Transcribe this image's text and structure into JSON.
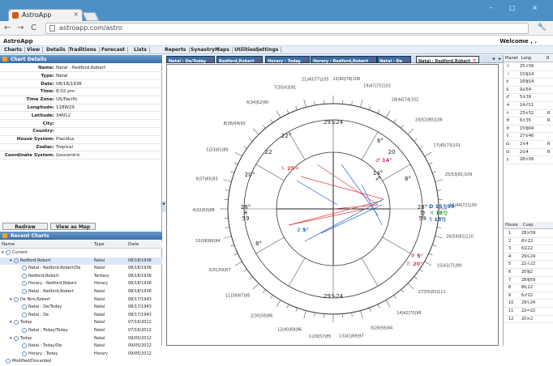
{
  "browser": {
    "tab_title": "AstroApp",
    "tab_close": "×",
    "window_controls": "– □ ×",
    "url": "astroapp.com/astro",
    "back_glyph": "←",
    "forward_glyph": "→",
    "reload_glyph": "C",
    "wrench_glyph": "🔧"
  },
  "app": {
    "name": "AstroApp",
    "welcome": "Welcome , ."
  },
  "menu": [
    "Charts",
    "View",
    "Details",
    "Traditions",
    "Forecast",
    "Lists",
    "Reports",
    "Synastry",
    "Maps",
    "Utilities",
    "Settings"
  ],
  "chart_details": {
    "header": "Chart Details",
    "rows": [
      {
        "label": "Name:",
        "value": "Natal : Redford,Robert"
      },
      {
        "label": "Type:",
        "value": "Natal"
      },
      {
        "label": "Date:",
        "value": "08/18/1936"
      },
      {
        "label": "Time:",
        "value": "8:02 pm"
      },
      {
        "label": "Time Zone:",
        "value": "US/Pacific"
      },
      {
        "label": "Longitude:",
        "value": "118W29"
      },
      {
        "label": "Latitude:",
        "value": "34N12"
      },
      {
        "label": "City:",
        "value": ""
      },
      {
        "label": "Country:",
        "value": ""
      },
      {
        "label": "House System:",
        "value": "Placidus"
      },
      {
        "label": "Zodiac:",
        "value": "Tropical"
      },
      {
        "label": "Coordinate System:",
        "value": "Geocentric"
      }
    ],
    "redraw": "Redraw",
    "view_map": "View as Map"
  },
  "recent_charts": {
    "header": "Recent Charts",
    "columns": [
      "Name",
      "Type",
      "Date"
    ],
    "rows": [
      {
        "name": "Current",
        "type": "",
        "date": "",
        "level": 0,
        "toggle": "▾"
      },
      {
        "name": "Redford,Robert",
        "type": "Natal",
        "date": "08/18/1936",
        "level": 1,
        "toggle": "▾",
        "selected": true
      },
      {
        "name": "Natal : Redford,Robert/De",
        "type": "Natal",
        "date": "08/18/1936",
        "level": 2,
        "toggle": ""
      },
      {
        "name": "Redford,Robert",
        "type": "Tertiary",
        "date": "08/18/1936",
        "level": 2,
        "toggle": ""
      },
      {
        "name": "Horary : Redford,Robert",
        "type": "Horary",
        "date": "08/18/1936",
        "level": 2,
        "toggle": ""
      },
      {
        "name": "Natal : Redford,Robert",
        "type": "Natal",
        "date": "08/18/1936",
        "level": 2,
        "toggle": ""
      },
      {
        "name": "De Niro,Robert",
        "type": "Natal",
        "date": "08/17/1943",
        "level": 1,
        "toggle": "▾"
      },
      {
        "name": "Natal : De/Today",
        "type": "Natal",
        "date": "08/17/1943",
        "level": 2,
        "toggle": ""
      },
      {
        "name": "Natal : De",
        "type": "Natal",
        "date": "08/17/1943",
        "level": 2,
        "toggle": ""
      },
      {
        "name": "Today",
        "type": "Natal",
        "date": "07/16/2012",
        "level": 1,
        "toggle": "▾"
      },
      {
        "name": "Natal : Today/Today",
        "type": "Natal",
        "date": "07/16/2012",
        "level": 2,
        "toggle": ""
      },
      {
        "name": "Today",
        "type": "Natal",
        "date": "09/05/2012",
        "level": 1,
        "toggle": "▾"
      },
      {
        "name": "Natal : Today/De",
        "type": "Natal",
        "date": "09/05/2012",
        "level": 2,
        "toggle": ""
      },
      {
        "name": "Horary : Today",
        "type": "Horary",
        "date": "09/05/2012",
        "level": 2,
        "toggle": ""
      },
      {
        "name": "Modified/Discarded",
        "type": "",
        "date": "",
        "level": 0,
        "toggle": ""
      }
    ]
  },
  "chart_tabs": [
    {
      "label": "Natal : De/Today",
      "active": false
    },
    {
      "label": "Redford,Robert",
      "active": false
    },
    {
      "label": "Horary : Today",
      "active": false
    },
    {
      "label": "Horary : Redford,Robert",
      "active": false
    },
    {
      "label": "Natal : De",
      "active": false
    },
    {
      "label": "Natal : Redford,Robert",
      "active": true
    }
  ],
  "wheel": {
    "cusp_labels": [
      "29♋24",
      "22°",
      "22",
      "20°",
      "28°\n♓\n59",
      "8°",
      "29♑24",
      "6°",
      "20",
      "8°",
      "28°\n♍\n59",
      "14°\n♐"
    ],
    "outer_degree_labels": [
      "21|40|77|105",
      "22|80|78|108",
      "19|47|75|103",
      "18|46|74|102",
      "24|52|80|108",
      "17|45|73|101",
      "25|53|81|109",
      "16|44|72|100",
      "26|54|82|110",
      "15|43|71|99",
      "27|55|83|111",
      "14|42|70|98",
      "0|28|56|84",
      "13|41|69|97",
      "1|29|57|85",
      "12|40|68|96",
      "2|30|58|86",
      "11|39|67|95",
      "3|31|59|87",
      "10|38|66|94",
      "4|32|60|88",
      "9|37|65|93",
      "5|33|61|89",
      "8|36|64|92",
      "6|34|62|90",
      "7|35|63|91"
    ],
    "planet_glyphs": [
      "D 15♍59",
      "♃ 18♍",
      "☿ 15♍",
      "♄ 25♒",
      "♆ 5°",
      "♇ 20°",
      "♀ 5°",
      "♂ 14°"
    ]
  },
  "planet_table": {
    "columns": [
      "Planet",
      "Long",
      "R"
    ],
    "rows": [
      {
        "p": "☉",
        "l": "25♌59",
        "r": ""
      },
      {
        "p": "☽",
        "l": "15♍14",
        "r": ""
      },
      {
        "p": "☿",
        "l": "18♍14",
        "r": ""
      },
      {
        "p": "♀",
        "l": "9♎54",
        "r": ""
      },
      {
        "p": "♂",
        "l": "5♋39",
        "r": ""
      },
      {
        "p": "♃",
        "l": "14♐11",
        "r": ""
      },
      {
        "p": "♄",
        "l": "23♓52",
        "r": "R"
      },
      {
        "p": "♅",
        "l": "6♉35",
        "r": "R"
      },
      {
        "p": "♆",
        "l": "15♍04",
        "r": ""
      },
      {
        "p": "♇",
        "l": "27♋46",
        "r": ""
      },
      {
        "p": "☊",
        "l": "2♑4",
        "r": "R"
      },
      {
        "p": "☋",
        "l": "2♋4",
        "r": "R"
      },
      {
        "p": "⚷",
        "l": "28♉09",
        "r": ""
      }
    ]
  },
  "house_table": {
    "columns": [
      "House",
      "Cusp"
    ],
    "rows": [
      {
        "h": "1",
        "c": "28♓59"
      },
      {
        "h": "2",
        "c": "8♉22"
      },
      {
        "h": "3",
        "c": "6♊22"
      },
      {
        "h": "4",
        "c": "29♋24"
      },
      {
        "h": "5",
        "c": "22♌22"
      },
      {
        "h": "6",
        "c": "20♍2"
      },
      {
        "h": "7",
        "c": "28♍59"
      },
      {
        "h": "8",
        "c": "8♏22"
      },
      {
        "h": "9",
        "c": "6♐22"
      },
      {
        "h": "10",
        "c": "29♑24"
      },
      {
        "h": "11",
        "c": "22♒22"
      },
      {
        "h": "12",
        "c": "20♓2"
      }
    ]
  }
}
